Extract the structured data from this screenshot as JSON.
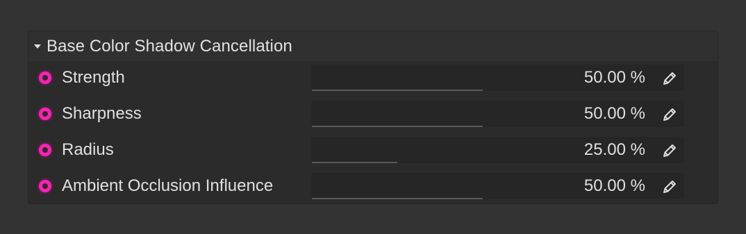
{
  "panel": {
    "title": "Base Color Shadow Cancellation",
    "caret_icon": "caret-down-icon",
    "accent_color": "#ff1fb5"
  },
  "parameters": [
    {
      "label": "Strength",
      "value_text": "50.00 %",
      "value": 0.5,
      "icon": "animation-keyframe-icon",
      "edit_icon": "pencil-icon"
    },
    {
      "label": "Sharpness",
      "value_text": "50.00 %",
      "value": 0.5,
      "icon": "animation-keyframe-icon",
      "edit_icon": "pencil-icon"
    },
    {
      "label": "Radius",
      "value_text": "25.00 %",
      "value": 0.25,
      "icon": "animation-keyframe-icon",
      "edit_icon": "pencil-icon"
    },
    {
      "label": "Ambient Occlusion Influence",
      "value_text": "50.00 %",
      "value": 0.5,
      "icon": "animation-keyframe-icon",
      "edit_icon": "pencil-icon"
    }
  ]
}
